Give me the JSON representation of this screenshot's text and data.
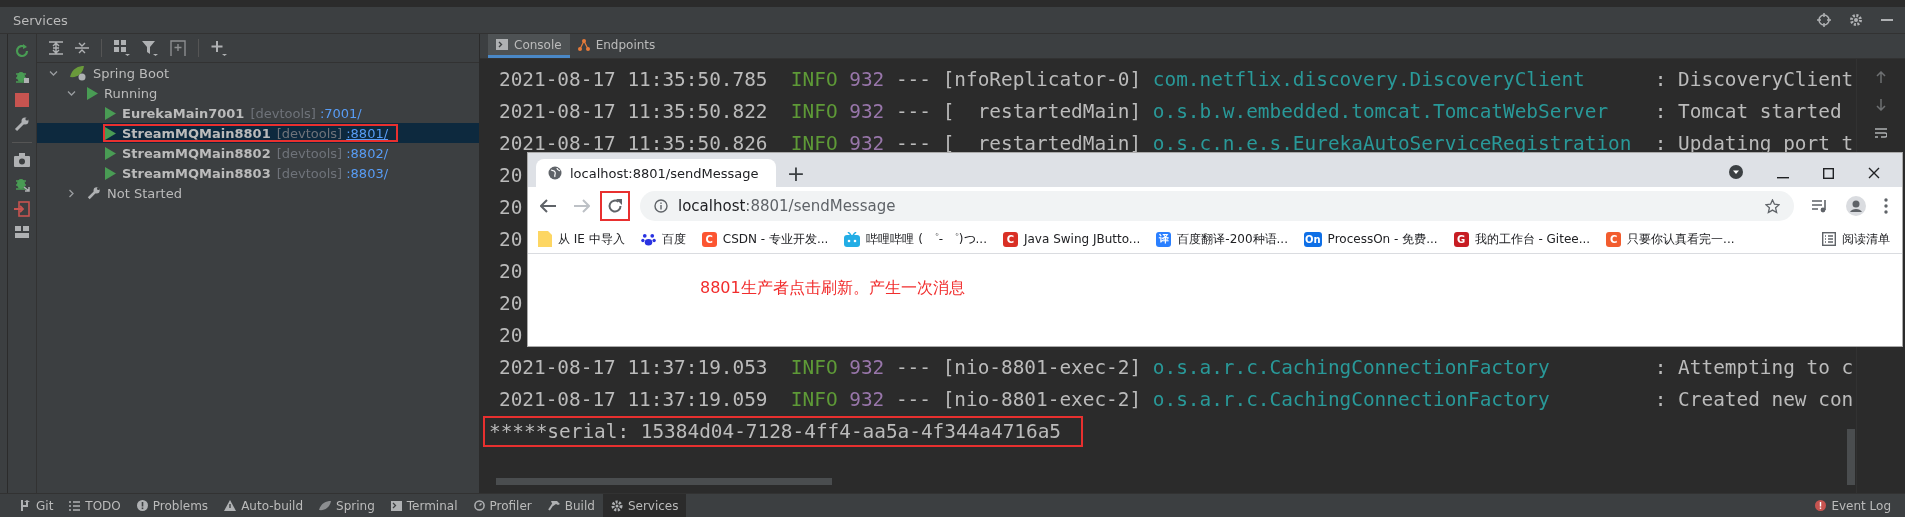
{
  "title": "Services",
  "tree": [
    {
      "kind": "group",
      "label": "Spring Boot",
      "expanded": true,
      "children": [
        {
          "kind": "status",
          "label": "Running",
          "expanded": true,
          "children": [
            {
              "kind": "app",
              "name": "EurekaMain7001",
              "tag": "[devtools]",
              "port": ":7001/",
              "selected": false,
              "annotated": false
            },
            {
              "kind": "app",
              "name": "StreamMQMain8801",
              "tag": "[devtools]",
              "port": ":8801/",
              "selected": true,
              "annotated": true
            },
            {
              "kind": "app",
              "name": "StreamMQMain8802",
              "tag": "[devtools]",
              "port": ":8802/",
              "selected": false,
              "annotated": false
            },
            {
              "kind": "app",
              "name": "StreamMQMain8803",
              "tag": "[devtools]",
              "port": ":8803/",
              "selected": false,
              "annotated": false
            }
          ]
        },
        {
          "kind": "config",
          "label": "Not Started",
          "expanded": false
        }
      ]
    }
  ],
  "console": {
    "tabs": [
      {
        "kind": "console",
        "label": "Console",
        "selected": true
      },
      {
        "kind": "endpoints",
        "label": "Endpoints",
        "selected": false
      }
    ],
    "lines": [
      {
        "kind": "log",
        "time": "2021-08-17 11:35:50.785",
        "severity": "INFO",
        "pid": "932",
        "sep": "---",
        "thread": "[nfoReplicator-0]",
        "logger": "com.netflix.discovery.DiscoveryClient",
        "message": ": DiscoveryClient"
      },
      {
        "kind": "log",
        "time": "2021-08-17 11:35:50.822",
        "severity": "INFO",
        "pid": "932",
        "sep": "---",
        "thread": "[  restartedMain]",
        "logger": "o.s.b.w.embedded.tomcat.TomcatWebServer",
        "message": ": Tomcat started"
      },
      {
        "kind": "log",
        "time": "2021-08-17 11:35:50.826",
        "severity": "INFO",
        "pid": "932",
        "sep": "---",
        "thread": "[  restartedMain]",
        "logger": "o.s.c.n.e.s.EurekaAutoServiceRegistration",
        "message": ": Updating port t"
      },
      {
        "kind": "plain",
        "text": "20",
        "annotated": false
      },
      {
        "kind": "plain",
        "text": "20",
        "annotated": false
      },
      {
        "kind": "plain",
        "text": "20",
        "annotated": false
      },
      {
        "kind": "plain",
        "text": "20",
        "annotated": false
      },
      {
        "kind": "plain",
        "text": "20",
        "annotated": false
      },
      {
        "kind": "plain",
        "text": "20",
        "annotated": false
      },
      {
        "kind": "log",
        "time": "2021-08-17 11:37:19.053",
        "severity": "INFO",
        "pid": "932",
        "sep": "---",
        "thread": "[nio-8801-exec-2]",
        "logger": "o.s.a.r.c.CachingConnectionFactory",
        "message": ": Attempting to c"
      },
      {
        "kind": "log",
        "time": "2021-08-17 11:37:19.059",
        "severity": "INFO",
        "pid": "932",
        "sep": "---",
        "thread": "[nio-8801-exec-2]",
        "logger": "o.s.a.r.c.CachingConnectionFactory",
        "message": ": Created new con"
      },
      {
        "kind": "plain",
        "text": "*****serial: 15384d04-7128-4ff4-aa5a-4f344a4716a5",
        "annotated": true
      }
    ]
  },
  "browser": {
    "tab_title": "localhost:8801/sendMessage",
    "new_tab": "+",
    "reload_annotated": true,
    "host": "localhost",
    "path": ":8801/sendMessage",
    "bookmarks": [
      {
        "kind": "folder",
        "label": "从 IE 中导入"
      },
      {
        "kind": "paw",
        "label": "百度"
      },
      {
        "kind": "badge",
        "glyph": "C",
        "color": "#fc5531",
        "label": "CSDN - 专业开发..."
      },
      {
        "kind": "tv",
        "label": "哔哩哔哩 ( ゜- ゜)つ..."
      },
      {
        "kind": "badge",
        "glyph": "C",
        "color": "#d93025",
        "label": "Java Swing JButto..."
      },
      {
        "kind": "badge",
        "glyph": "译",
        "color": "#2a7fff",
        "label": "百度翻译-200种语..."
      },
      {
        "kind": "badge",
        "glyph": "On",
        "color": "#0e6fe6",
        "label": "ProcessOn - 免费..."
      },
      {
        "kind": "badge",
        "glyph": "G",
        "color": "#c71d23",
        "label": "我的工作台 - Gitee..."
      },
      {
        "kind": "badge",
        "glyph": "C",
        "color": "#f25c2e",
        "label": "只要你认真看完一..."
      }
    ],
    "reading_list": "阅读清单",
    "page_text": "8801生产者点击刷新。产生一次消息"
  },
  "bottom_tools": [
    {
      "kind": "git",
      "label": "Git",
      "selected": false
    },
    {
      "kind": "todo",
      "label": "TODO",
      "selected": false
    },
    {
      "kind": "problems",
      "label": "Problems",
      "selected": false
    },
    {
      "kind": "build-auto",
      "label": "Auto-build",
      "selected": false
    },
    {
      "kind": "spring",
      "label": "Spring",
      "selected": false
    },
    {
      "kind": "terminal",
      "label": "Terminal",
      "selected": false
    },
    {
      "kind": "profiler",
      "label": "Profiler",
      "selected": false
    },
    {
      "kind": "build",
      "label": "Build",
      "selected": false
    },
    {
      "kind": "services",
      "label": "Services",
      "selected": true
    }
  ],
  "event_log": "Event Log"
}
